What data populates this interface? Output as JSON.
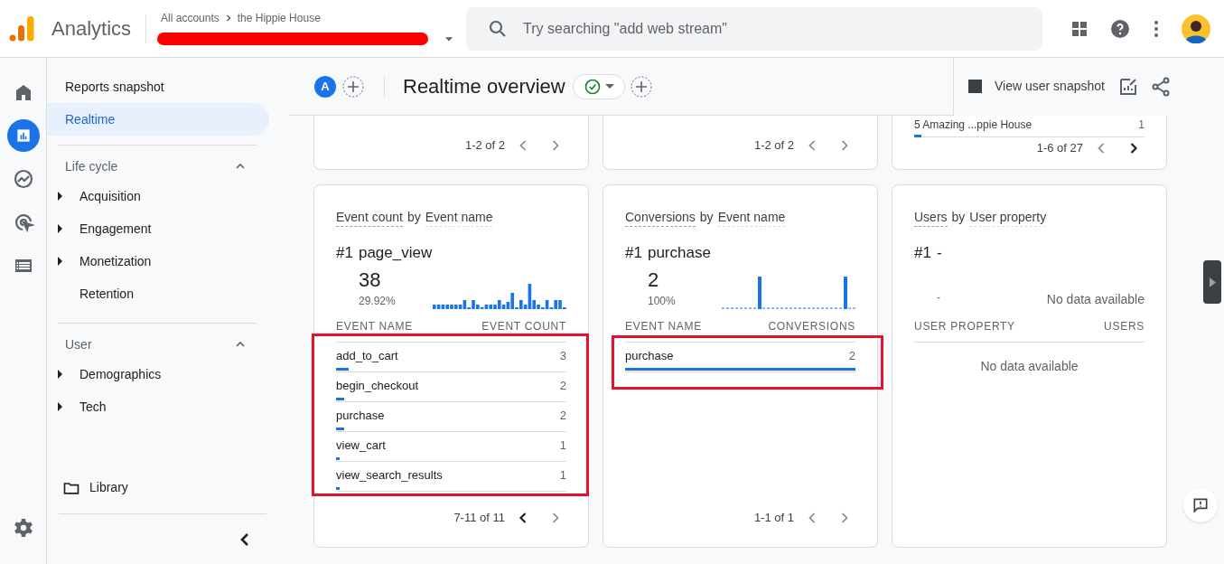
{
  "app": {
    "name": "Analytics",
    "breadcrumb": [
      "All accounts",
      "the Hippie House"
    ]
  },
  "search": {
    "placeholder": "Try searching \"add web stream\""
  },
  "rail": [
    {
      "kind": "home",
      "selected": false
    },
    {
      "kind": "reports",
      "selected": true
    },
    {
      "kind": "explore",
      "selected": false
    },
    {
      "kind": "advertising",
      "selected": false
    },
    {
      "kind": "configure",
      "selected": false
    }
  ],
  "nav": {
    "items": [
      {
        "label": "Reports snapshot",
        "selected": false
      },
      {
        "label": "Realtime",
        "selected": true
      }
    ],
    "sections": [
      {
        "title": "Life cycle",
        "expanded": true,
        "items": [
          {
            "label": "Acquisition",
            "expandable": true
          },
          {
            "label": "Engagement",
            "expandable": true
          },
          {
            "label": "Monetization",
            "expandable": true
          },
          {
            "label": "Retention",
            "expandable": false
          }
        ]
      },
      {
        "title": "User",
        "expanded": true,
        "items": [
          {
            "label": "Demographics",
            "expandable": true
          },
          {
            "label": "Tech",
            "expandable": true
          }
        ]
      }
    ],
    "library": "Library"
  },
  "header": {
    "comparison": "A",
    "title": "Realtime overview",
    "snapshot": "View user snapshot"
  },
  "top_cards": [
    {
      "pagination": "1-2 of 2",
      "prev_enabled": false,
      "next_enabled": false
    },
    {
      "pagination": "1-2 of 2",
      "prev_enabled": false,
      "next_enabled": false
    },
    {
      "rows": [
        {
          "name": "5 Amazing ...ppie House",
          "value": "1",
          "level": 0.03
        }
      ],
      "pagination": "1-6 of 27",
      "prev_enabled": false,
      "next_enabled": true
    }
  ],
  "cards": [
    {
      "metric": "Event count",
      "connector": "by",
      "dimension": "Event name",
      "rank": "#1",
      "top_name": "page_view",
      "top_value": "38",
      "top_share": "29.92%",
      "kind": "bars",
      "columns": [
        "EVENT NAME",
        "EVENT COUNT"
      ],
      "rows": [
        {
          "name": "add_to_cart",
          "value": "3",
          "level": 0.055
        },
        {
          "name": "begin_checkout",
          "value": "2",
          "level": 0.037
        },
        {
          "name": "purchase",
          "value": "2",
          "level": 0.037
        },
        {
          "name": "view_cart",
          "value": "1",
          "level": 0.015
        },
        {
          "name": "view_search_results",
          "value": "1",
          "level": 0.015
        }
      ],
      "pagination": "7-11 of 11",
      "prev_enabled": true,
      "next_enabled": false,
      "highlighted": true
    },
    {
      "metric": "Conversions",
      "connector": "by",
      "dimension": "Event name",
      "rank": "#1",
      "top_name": "purchase",
      "top_value": "2",
      "top_share": "100%",
      "kind": "spikes",
      "columns": [
        "EVENT NAME",
        "CONVERSIONS"
      ],
      "rows": [
        {
          "name": "purchase",
          "value": "2",
          "level": 1
        }
      ],
      "pagination": "1-1 of 1",
      "prev_enabled": false,
      "next_enabled": false,
      "highlighted": true
    },
    {
      "metric": "Users",
      "connector": "by",
      "dimension": "User property",
      "rank": "#1",
      "top_name": "-",
      "top_share": "-",
      "kind": "empty",
      "spark_empty": "No data available",
      "columns": [
        "USER PROPERTY",
        "USERS"
      ],
      "empty": "No data available",
      "highlighted": false
    }
  ]
}
